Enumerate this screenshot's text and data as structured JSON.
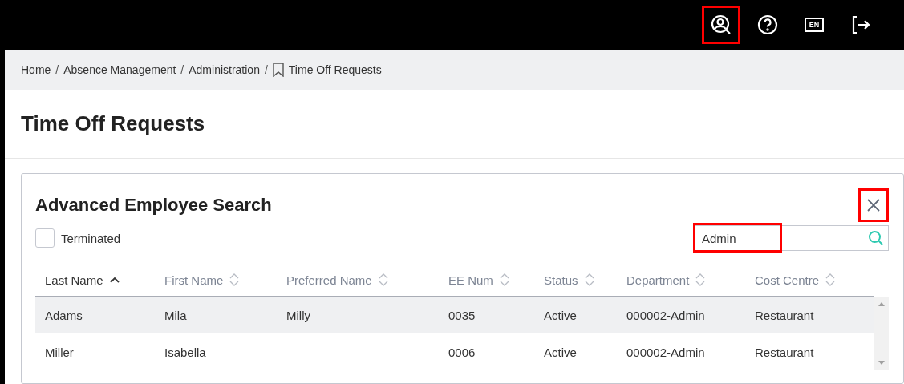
{
  "header": {
    "icons": [
      {
        "kind": "user-search",
        "highlighted": true
      },
      {
        "kind": "help",
        "highlighted": false
      },
      {
        "kind": "language",
        "label": "EN",
        "highlighted": false
      },
      {
        "kind": "logout",
        "highlighted": false
      }
    ]
  },
  "breadcrumb": [
    {
      "label": "Home",
      "bookmark": false
    },
    {
      "separator": "/",
      "label": "Absence Management",
      "bookmark": false
    },
    {
      "separator": "/",
      "label": "Administration",
      "bookmark": false
    },
    {
      "separator": "/",
      "label": "Time Off Requests",
      "bookmark": true
    }
  ],
  "page_title": "Time Off Requests",
  "dialog": {
    "title": "Advanced Employee Search",
    "close_highlighted": true,
    "terminated": {
      "label": "Terminated",
      "checked": false
    },
    "search": {
      "value": "Admin",
      "highlighted": true
    },
    "table": {
      "columns": [
        {
          "label": "Last Name",
          "sorted": true
        },
        {
          "label": "First Name",
          "sorted": false
        },
        {
          "label": "Preferred Name",
          "sorted": false
        },
        {
          "label": "EE Num",
          "sorted": false
        },
        {
          "label": "Status",
          "sorted": false
        },
        {
          "label": "Department",
          "sorted": false
        },
        {
          "label": "Cost Centre",
          "sorted": false
        }
      ],
      "rows": [
        {
          "selected": true,
          "cells": [
            "Adams",
            "Mila",
            "Milly",
            "0035",
            "Active",
            "000002-Admin",
            "Restaurant"
          ]
        },
        {
          "selected": false,
          "cells": [
            "Miller",
            "Isabella",
            "",
            "0006",
            "Active",
            "000002-Admin",
            "Restaurant"
          ]
        }
      ]
    }
  }
}
